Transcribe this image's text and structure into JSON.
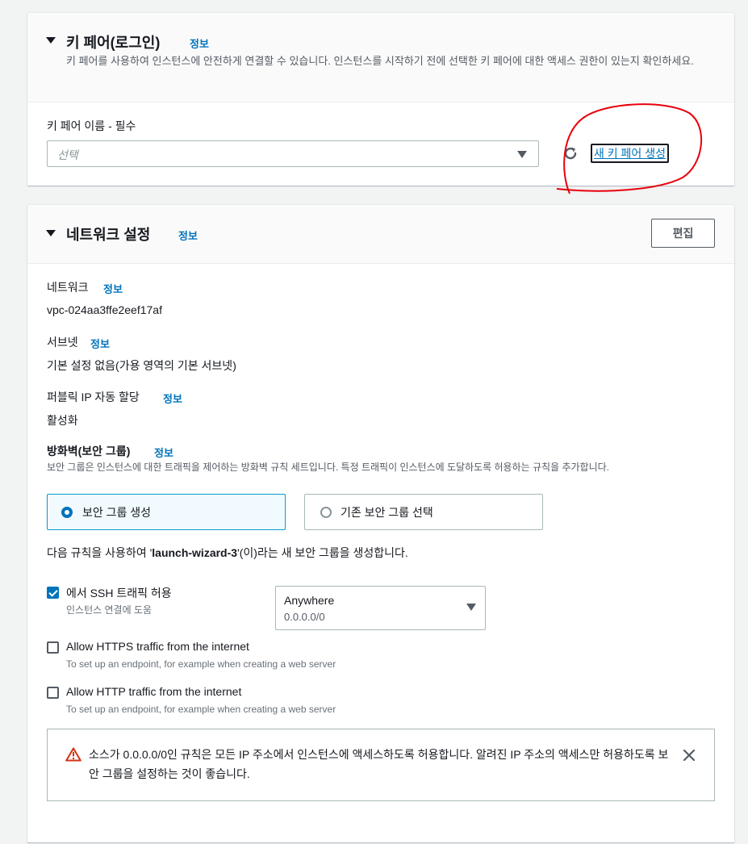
{
  "key_pair": {
    "title": "키 페어(로그인)",
    "info": "정보",
    "description": "키 페어를 사용하여 인스턴스에 안전하게 연결할 수 있습니다. 인스턴스를 시작하기 전에 선택한 키 페어에 대한 액세스 권한이 있는지 확인하세요.",
    "name_label": "키 페어 이름 - 필수",
    "select_placeholder": "선택",
    "create_link": "새 키 페어 생성"
  },
  "network_settings": {
    "title": "네트워크 설정",
    "info": "정보",
    "edit_button": "편집",
    "network": {
      "label": "네트워크",
      "info": "정보",
      "value": "vpc-024aa3ffe2eef17af"
    },
    "subnet": {
      "label": "서브넷",
      "info": "정보",
      "value": "기본 설정 없음(가용 영역의 기본 서브넷)"
    },
    "public_ip": {
      "label": "퍼블릭 IP 자동 할당",
      "info": "정보",
      "value": "활성화"
    },
    "firewall": {
      "label": "방화벽(보안 그룹)",
      "info": "정보",
      "description": "보안 그룹은 인스턴스에 대한 트래픽을 제어하는 방화벽 규칙 세트입니다. 특정 트래픽이 인스턴스에 도달하도록 허용하는 규칙을 추가합니다.",
      "options": [
        {
          "label": "보안 그룹 생성",
          "selected": true
        },
        {
          "label": "기존 보안 그룹 선택",
          "selected": false
        }
      ],
      "rule_text_prefix": "다음 규칙을 사용하여 '",
      "rule_text_name": "launch-wizard-3",
      "rule_text_suffix": "'(이)라는 새 보안 그룹을 생성합니다."
    },
    "rules": [
      {
        "label": "에서 SSH 트래픽 허용",
        "sub": "인스턴스 연결에 도움",
        "checked": true
      },
      {
        "label": "Allow HTTPS traffic from the internet",
        "sub": "To set up an endpoint, for example when creating a web server",
        "checked": false
      },
      {
        "label": "Allow HTTP traffic from the internet",
        "sub": "To set up an endpoint, for example when creating a web server",
        "checked": false
      }
    ],
    "ssh_source": {
      "value": "Anywhere",
      "sub": "0.0.0.0/0"
    },
    "warning": {
      "text": "소스가 0.0.0.0/0인 규칙은 모든 IP 주소에서 인스턴스에 액세스하도록 허용합니다. 알려진 IP 주소의 액세스만 허용하도록 보안 그룹을 설정하는 것이 좋습니다."
    }
  },
  "colors": {
    "link": "#0073bb",
    "annotation": "#e8000b",
    "warning": "#d13212"
  }
}
